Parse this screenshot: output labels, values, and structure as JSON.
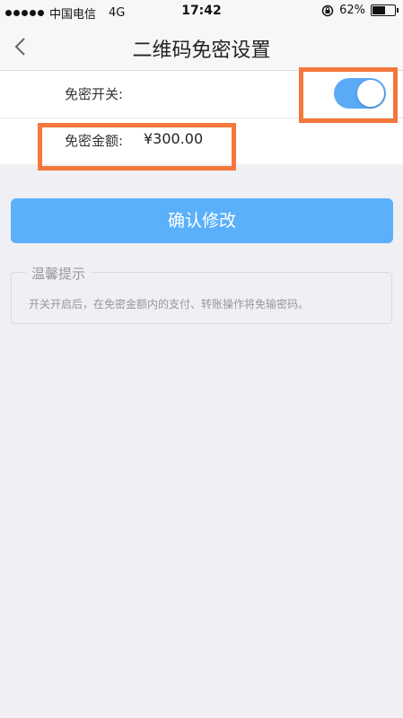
{
  "status_bar": {
    "carrier": "中国电信",
    "network": "4G",
    "time": "17:42",
    "battery": "62%",
    "battery_level": 0.62
  },
  "nav": {
    "title": "二维码免密设置"
  },
  "settings": {
    "switch_label": "免密开关:",
    "switch_on": true,
    "amount_label": "免密金额:",
    "amount_value": "¥300.00"
  },
  "confirm_button": "确认修改",
  "tips": {
    "title": "温馨提示",
    "text": "开关开启后，在免密金额内的支付、转账操作将免输密码。"
  },
  "colors": {
    "accent": "#5bb0fb",
    "highlight": "#f4773c"
  }
}
